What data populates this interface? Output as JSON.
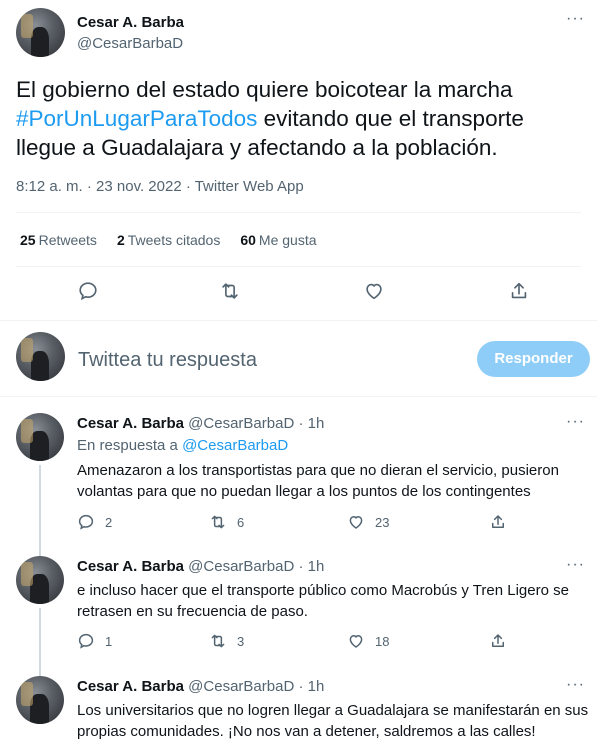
{
  "main": {
    "name": "Cesar A. Barba",
    "handle": "@CesarBarbaD",
    "text_before": "El gobierno del estado quiere boicotear la marcha ",
    "hashtag": "#PorUnLugarParaTodos",
    "text_after": " evitando que el transporte llegue a Guadalajara y afectando a la población.",
    "meta": "8:12 a. m. · 23 nov. 2022 · Twitter Web App",
    "stats": {
      "retweets_count": "25",
      "retweets_label": "Retweets",
      "quotes_count": "2",
      "quotes_label": "Tweets citados",
      "likes_count": "60",
      "likes_label": "Me gusta"
    },
    "more": "···"
  },
  "reply_box": {
    "placeholder": "Twittea tu respuesta",
    "button": "Responder"
  },
  "replies": [
    {
      "name": "Cesar A. Barba",
      "handle": "@CesarBarbaD",
      "time": "· 1h",
      "in_reply_prefix": "En respuesta a ",
      "in_reply_handle": "@CesarBarbaD",
      "text": "Amenazaron a los transportistas para que no dieran el servicio, pusieron volantas para que no puedan llegar a los puntos de los contingentes",
      "replies": "2",
      "retweets": "6",
      "likes": "23",
      "more": "···"
    },
    {
      "name": "Cesar A. Barba",
      "handle": "@CesarBarbaD",
      "time": "· 1h",
      "text": "e incluso hacer que el transporte público como Macrobús y Tren Ligero se retrasen en su frecuencia de paso.",
      "replies": "1",
      "retweets": "3",
      "likes": "18",
      "more": "···"
    },
    {
      "name": "Cesar A. Barba",
      "handle": "@CesarBarbaD",
      "time": "· 1h",
      "text": "Los universitarios que no logren llegar a Guadalajara se manifestarán en sus propias comunidades. ¡No nos van a detener, saldremos a las calles!",
      "more": "···"
    }
  ],
  "colors": {
    "accent": "#1d9bf0",
    "secondary_text": "#536471",
    "button_disabled": "#8ecdf7"
  }
}
